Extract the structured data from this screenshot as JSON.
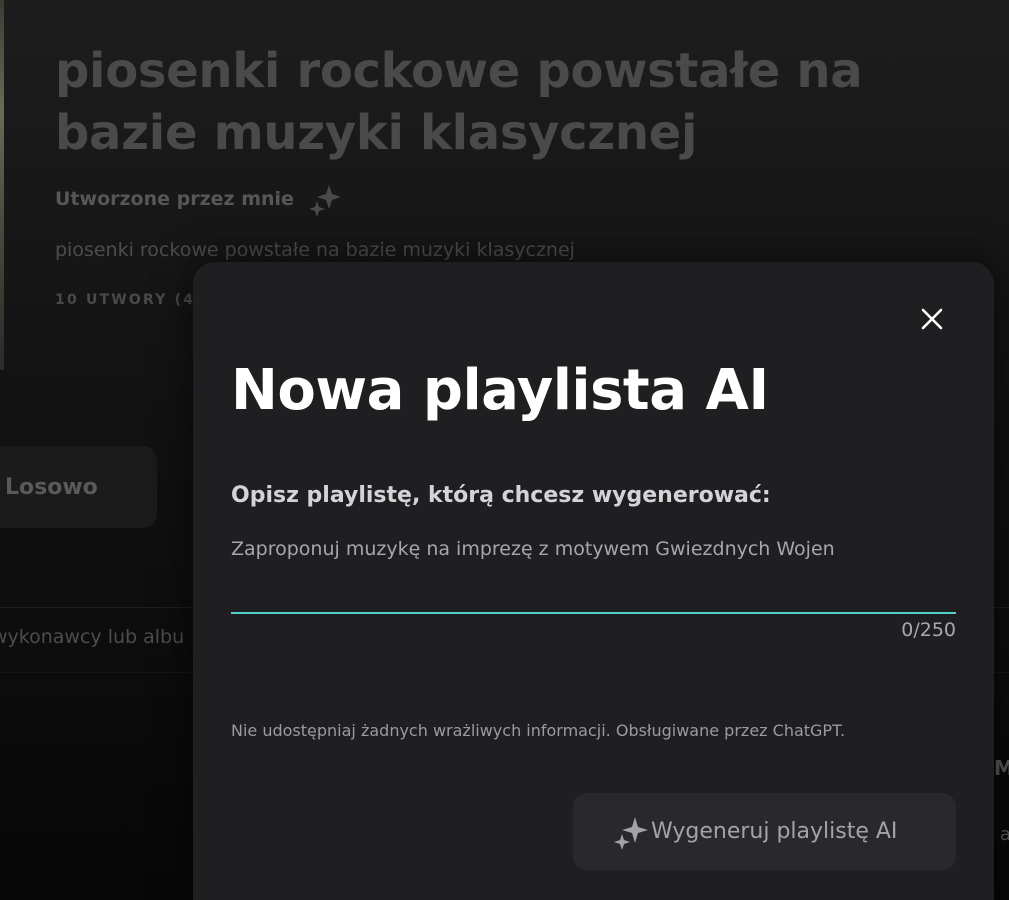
{
  "background": {
    "playlist_title": "piosenki rockowe powstałe na bazie muzyki klasycznej",
    "creator_label": "Utworzone przez mnie",
    "creator_icon": "sparkles-icon",
    "description": "piosenki rockowe powstałe na bazie muzyki klasycznej",
    "track_count": "10 UTWORY (4",
    "shuffle_label": "Losowo",
    "search_hint": "wykonawcy lub albu",
    "edge_text_1": "M",
    "edge_text_2": "a"
  },
  "modal": {
    "title": "Nowa playlista AI",
    "close_icon": "close-icon",
    "field_label": "Opisz playlistę, którą chcesz wygenerować:",
    "input": {
      "value": "",
      "placeholder": "Zaproponuj muzykę na imprezę z motywem Gwiezdnych Wojen"
    },
    "char_counter": "0/250",
    "disclaimer": "Nie udostępniaj żadnych wrażliwych informacji. Obsługiwane przez ChatGPT.",
    "generate_button": {
      "label": "Wygeneruj playlistę AI",
      "icon": "sparkles-icon",
      "enabled": false
    }
  },
  "colors": {
    "accent": "#4fd1c5",
    "modal_background": "#1f1f21",
    "title_text": "#ffffff"
  }
}
